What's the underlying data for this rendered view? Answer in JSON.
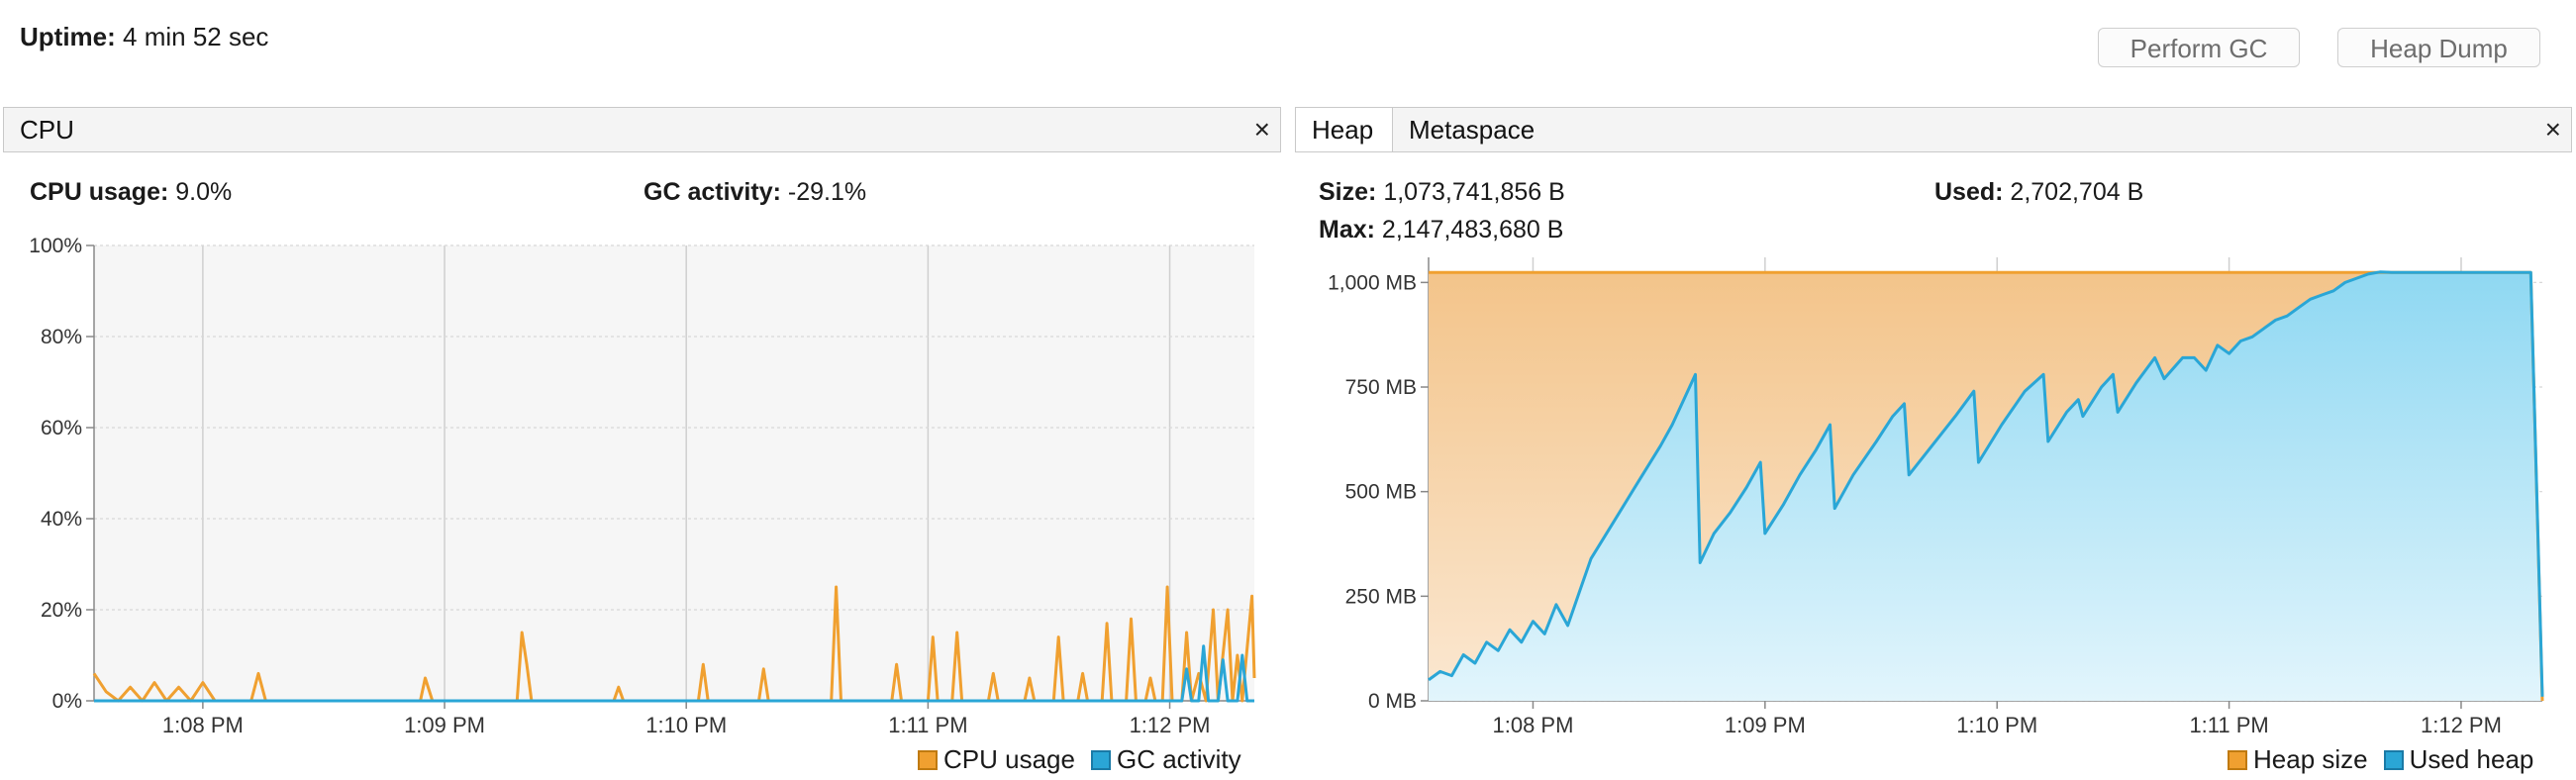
{
  "header": {
    "uptime_label": "Uptime:",
    "uptime_value": "4 min 52 sec",
    "perform_gc_label": "Perform GC",
    "heap_dump_label": "Heap Dump"
  },
  "cpu_panel": {
    "tab_label": "CPU",
    "close_glyph": "×",
    "cpu_usage_label": "CPU usage:",
    "cpu_usage_value": "9.0%",
    "gc_activity_label": "GC activity:",
    "gc_activity_value": "-29.1%",
    "legend": [
      {
        "label": "CPU usage",
        "color": "#f0a030"
      },
      {
        "label": "GC activity",
        "color": "#2aa6d6"
      }
    ]
  },
  "heap_panel": {
    "tabs": [
      {
        "label": "Heap"
      },
      {
        "label": "Metaspace"
      }
    ],
    "close_glyph": "×",
    "size_label": "Size:",
    "size_value": "1,073,741,856 B",
    "used_label": "Used:",
    "used_value": "2,702,704 B",
    "max_label": "Max:",
    "max_value": "2,147,483,680 B",
    "legend": [
      {
        "label": "Heap size",
        "color": "#f0a030"
      },
      {
        "label": "Used heap",
        "color": "#2aa6d6"
      }
    ]
  },
  "chart_data": [
    {
      "type": "line",
      "title": "",
      "xlabel": "",
      "ylabel": "",
      "x_ticks": [
        "1:08 PM",
        "1:09 PM",
        "1:10 PM",
        "1:11 PM",
        "1:12 PM"
      ],
      "y_ticks": [
        "0%",
        "20%",
        "40%",
        "60%",
        "80%",
        "100%"
      ],
      "ylim": [
        0,
        100
      ],
      "x_range_minutes": [
        -0.45,
        4.35
      ],
      "grid": true,
      "legend_position": "bottom-right",
      "series": [
        {
          "name": "CPU usage",
          "color": "#f0a030",
          "points": [
            [
              -0.45,
              6
            ],
            [
              -0.4,
              2
            ],
            [
              -0.35,
              0
            ],
            [
              -0.3,
              3
            ],
            [
              -0.25,
              0
            ],
            [
              -0.2,
              4
            ],
            [
              -0.15,
              0
            ],
            [
              -0.1,
              3
            ],
            [
              -0.05,
              0
            ],
            [
              0.0,
              4
            ],
            [
              0.05,
              0
            ],
            [
              0.2,
              0
            ],
            [
              0.23,
              6
            ],
            [
              0.26,
              0
            ],
            [
              0.5,
              0
            ],
            [
              0.8,
              0
            ],
            [
              0.9,
              0
            ],
            [
              0.92,
              5
            ],
            [
              0.95,
              0
            ],
            [
              1.3,
              0
            ],
            [
              1.32,
              15
            ],
            [
              1.34,
              8
            ],
            [
              1.36,
              0
            ],
            [
              1.6,
              0
            ],
            [
              1.7,
              0
            ],
            [
              1.72,
              3
            ],
            [
              1.74,
              0
            ],
            [
              2.05,
              0
            ],
            [
              2.07,
              8
            ],
            [
              2.09,
              0
            ],
            [
              2.3,
              0
            ],
            [
              2.32,
              7
            ],
            [
              2.34,
              0
            ],
            [
              2.6,
              0
            ],
            [
              2.62,
              25
            ],
            [
              2.64,
              0
            ],
            [
              2.85,
              0
            ],
            [
              2.87,
              8
            ],
            [
              2.89,
              0
            ],
            [
              3.0,
              0
            ],
            [
              3.02,
              14
            ],
            [
              3.04,
              0
            ],
            [
              3.1,
              0
            ],
            [
              3.12,
              15
            ],
            [
              3.14,
              0
            ],
            [
              3.25,
              0
            ],
            [
              3.27,
              6
            ],
            [
              3.29,
              0
            ],
            [
              3.4,
              0
            ],
            [
              3.42,
              5
            ],
            [
              3.44,
              0
            ],
            [
              3.52,
              0
            ],
            [
              3.54,
              14
            ],
            [
              3.56,
              0
            ],
            [
              3.62,
              0
            ],
            [
              3.64,
              6
            ],
            [
              3.66,
              0
            ],
            [
              3.72,
              0
            ],
            [
              3.74,
              17
            ],
            [
              3.76,
              0
            ],
            [
              3.82,
              0
            ],
            [
              3.84,
              18
            ],
            [
              3.86,
              0
            ],
            [
              3.9,
              0
            ],
            [
              3.92,
              5
            ],
            [
              3.94,
              0
            ],
            [
              3.97,
              0
            ],
            [
              3.99,
              25
            ],
            [
              4.01,
              0
            ],
            [
              4.05,
              0
            ],
            [
              4.07,
              15
            ],
            [
              4.09,
              0
            ],
            [
              4.12,
              6
            ],
            [
              4.15,
              0
            ],
            [
              4.18,
              20
            ],
            [
              4.2,
              0
            ],
            [
              4.24,
              20
            ],
            [
              4.26,
              0
            ],
            [
              4.28,
              10
            ],
            [
              4.3,
              0
            ],
            [
              4.34,
              23
            ],
            [
              4.35,
              5
            ]
          ]
        },
        {
          "name": "GC activity",
          "color": "#2aa6d6",
          "points": [
            [
              -0.45,
              0
            ],
            [
              4.05,
              0
            ],
            [
              4.07,
              7
            ],
            [
              4.09,
              0
            ],
            [
              4.12,
              0
            ],
            [
              4.14,
              12
            ],
            [
              4.16,
              0
            ],
            [
              4.2,
              0
            ],
            [
              4.22,
              9
            ],
            [
              4.24,
              0
            ],
            [
              4.28,
              0
            ],
            [
              4.3,
              10
            ],
            [
              4.32,
              0
            ],
            [
              4.35,
              0
            ]
          ]
        }
      ]
    },
    {
      "type": "area",
      "title": "",
      "xlabel": "",
      "ylabel": "",
      "x_ticks": [
        "1:08 PM",
        "1:09 PM",
        "1:10 PM",
        "1:11 PM",
        "1:12 PM"
      ],
      "y_ticks": [
        "0 MB",
        "250 MB",
        "500 MB",
        "750 MB",
        "1,000 MB"
      ],
      "ylim_mb": [
        0,
        1060
      ],
      "x_range_minutes": [
        -0.45,
        4.35
      ],
      "grid": true,
      "legend_position": "bottom-right",
      "series": [
        {
          "name": "Heap size",
          "color": "#f0a030",
          "points": [
            [
              -0.45,
              1024
            ],
            [
              4.3,
              1024
            ],
            [
              4.35,
              0
            ]
          ]
        },
        {
          "name": "Used heap",
          "color": "#2aa6d6",
          "points": [
            [
              -0.45,
              50
            ],
            [
              -0.4,
              70
            ],
            [
              -0.35,
              60
            ],
            [
              -0.3,
              110
            ],
            [
              -0.25,
              90
            ],
            [
              -0.2,
              140
            ],
            [
              -0.15,
              120
            ],
            [
              -0.1,
              170
            ],
            [
              -0.05,
              140
            ],
            [
              0.0,
              190
            ],
            [
              0.05,
              160
            ],
            [
              0.1,
              230
            ],
            [
              0.15,
              180
            ],
            [
              0.2,
              260
            ],
            [
              0.25,
              340
            ],
            [
              0.35,
              430
            ],
            [
              0.45,
              520
            ],
            [
              0.55,
              610
            ],
            [
              0.6,
              660
            ],
            [
              0.65,
              720
            ],
            [
              0.7,
              780
            ],
            [
              0.72,
              330
            ],
            [
              0.78,
              400
            ],
            [
              0.85,
              450
            ],
            [
              0.92,
              510
            ],
            [
              0.98,
              570
            ],
            [
              1.0,
              400
            ],
            [
              1.08,
              470
            ],
            [
              1.15,
              540
            ],
            [
              1.22,
              600
            ],
            [
              1.28,
              660
            ],
            [
              1.3,
              460
            ],
            [
              1.38,
              540
            ],
            [
              1.48,
              620
            ],
            [
              1.55,
              680
            ],
            [
              1.6,
              710
            ],
            [
              1.62,
              540
            ],
            [
              1.72,
              610
            ],
            [
              1.82,
              680
            ],
            [
              1.9,
              740
            ],
            [
              1.92,
              570
            ],
            [
              2.02,
              660
            ],
            [
              2.12,
              740
            ],
            [
              2.2,
              780
            ],
            [
              2.22,
              620
            ],
            [
              2.3,
              690
            ],
            [
              2.35,
              720
            ],
            [
              2.37,
              680
            ],
            [
              2.45,
              750
            ],
            [
              2.5,
              780
            ],
            [
              2.52,
              690
            ],
            [
              2.6,
              760
            ],
            [
              2.68,
              820
            ],
            [
              2.72,
              770
            ],
            [
              2.8,
              820
            ],
            [
              2.85,
              820
            ],
            [
              2.9,
              790
            ],
            [
              2.95,
              850
            ],
            [
              3.0,
              830
            ],
            [
              3.05,
              860
            ],
            [
              3.1,
              870
            ],
            [
              3.15,
              890
            ],
            [
              3.2,
              910
            ],
            [
              3.25,
              920
            ],
            [
              3.3,
              940
            ],
            [
              3.35,
              960
            ],
            [
              3.4,
              970
            ],
            [
              3.45,
              980
            ],
            [
              3.5,
              1000
            ],
            [
              3.55,
              1010
            ],
            [
              3.6,
              1020
            ],
            [
              3.65,
              1025
            ],
            [
              3.7,
              1024
            ],
            [
              3.75,
              1024
            ],
            [
              4.0,
              1024
            ],
            [
              4.2,
              1024
            ],
            [
              4.3,
              1024
            ],
            [
              4.35,
              10
            ]
          ]
        }
      ]
    }
  ]
}
